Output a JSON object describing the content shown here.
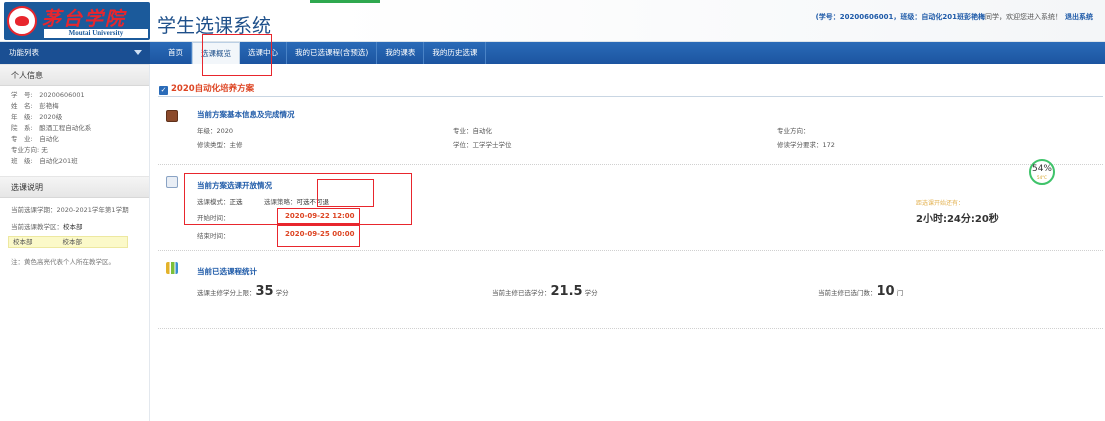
{
  "header": {
    "logo_cn": "茅台学院",
    "logo_en": "Moutai University",
    "system_title": "学生选课系统",
    "user_prefix": "(学号：",
    "student_no": "20200606001",
    "class_prefix": "，班级：",
    "class_name": "自动化201班",
    "user_name": "彭艳梅",
    "user_suffix": "同学，欢迎您进入系统！",
    "logout": "退出系统"
  },
  "nav": {
    "menu_label": "功能列表",
    "tabs": [
      "首页",
      "选课概览",
      "选课中心",
      "我的已选课程(含预选)",
      "我的课表",
      "我的历史选课"
    ],
    "active_tab": "选课概览"
  },
  "sidebar": {
    "personal_title": "个人信息",
    "info": [
      "学　号:　20200606001",
      "姓　名:　彭艳梅",
      "年　级:　2020级",
      "院　系:　酿酒工程自动化系",
      "专　业:　自动化",
      "专业方向: 无",
      "班　级:　自动化201班"
    ],
    "rules_title": "选课说明",
    "term_label": "当前选课学期：",
    "term_value": "2020-2021学年第1学期",
    "campus_label": "当前选课教学区：",
    "campus_value": "校本部",
    "campus_row": [
      "校本部",
      "校本部"
    ],
    "note": "注：黄色高亮代表个人所在教学区。"
  },
  "main": {
    "plan_title": "2020自动化培养方案",
    "basic": {
      "title": "当前方案基本信息及完成情况",
      "grade": "年级：2020",
      "study_type": "修读类型：主修",
      "major": "专业：自动化",
      "degree": "学位：工学学士学位",
      "direction": "专业方向：",
      "credits_req": "修读学分要求：172"
    },
    "open": {
      "title": "当前方案选课开放情况",
      "mode_label": "选课模式：",
      "mode_value": "正选",
      "policy_label": "选课策略：",
      "policy_value": "可选不可退",
      "start_label": "开始时间：",
      "start_value": "2020-09-22 12:00",
      "end_label": "结束时间：",
      "end_value": "2020-09-25 00:00"
    },
    "stats": {
      "title": "当前已选课程统计",
      "max_label": "选课主修学分上限：",
      "max_value": "35",
      "sel_label": "当前主修已选学分：",
      "sel_value": "21.5",
      "count_label": "当前主修已选门数：",
      "count_value": "10",
      "unit_credit": "学分",
      "unit_course": "门"
    },
    "countdown_label": "距选课开始还有：",
    "countdown_value": "2小时:24分:20秒",
    "gauge": {
      "percent": "54%",
      "temp": "54°C"
    }
  },
  "colors": {
    "accent": "#2a6bb8",
    "highlight": "#e8262d",
    "date_red": "#d42"
  }
}
